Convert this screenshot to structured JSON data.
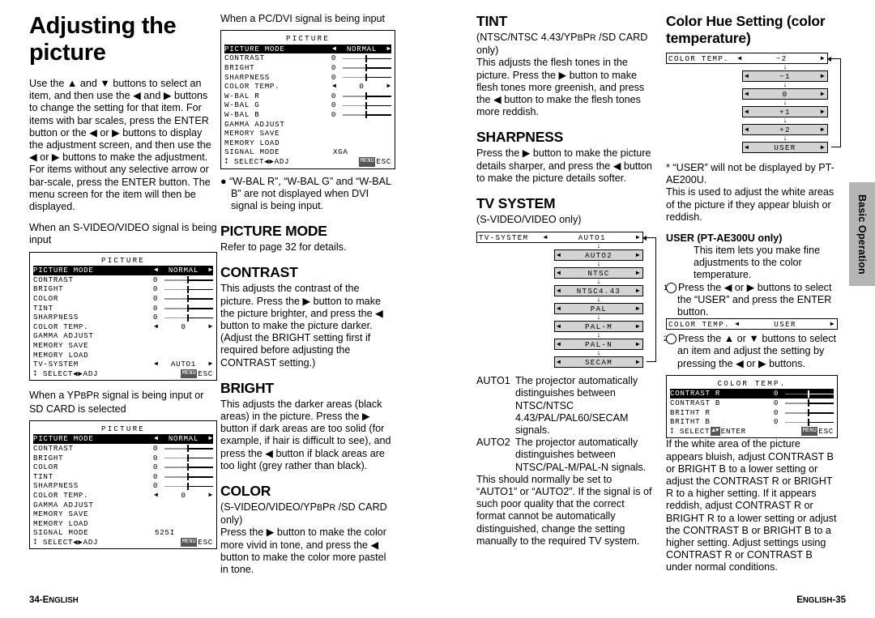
{
  "side_tab": {
    "label": "Basic Operation"
  },
  "footer": {
    "left": "34-ENGLISH",
    "right": "ENGLISH-35"
  },
  "col1": {
    "title": "Adjusting the picture",
    "p1": "Use the ▲ and ▼ buttons to select an item, and then use the ◀ and ▶ buttons to change the setting for that item. For items with bar scales, press the ENTER button or the ◀ or ▶ buttons to display the adjustment screen, and then use the ◀ or ▶ buttons to make the adjustment. For items without any selective arrow or bar-scale, press the ENTER button. The menu screen for the item will then be displayed.",
    "caption_svideo": "When an S-VIDEO/VIDEO signal is being input",
    "caption_ypbpr": "When a YPBPR signal is being input or SD CARD is selected",
    "menu_svideo": {
      "title": "PICTURE",
      "rows": [
        {
          "label": "PICTURE MODE",
          "type": "choice",
          "value": "NORMAL",
          "highlight": true
        },
        {
          "label": "CONTRAST",
          "type": "bar",
          "value": "0"
        },
        {
          "label": "BRIGHT",
          "type": "bar",
          "value": "0"
        },
        {
          "label": "COLOR",
          "type": "bar",
          "value": "0"
        },
        {
          "label": "TINT",
          "type": "bar",
          "value": "0"
        },
        {
          "label": "SHARPNESS",
          "type": "bar",
          "value": "0"
        },
        {
          "label": "COLOR  TEMP.",
          "type": "choice",
          "value": "0"
        },
        {
          "label": "GAMMA  ADJUST",
          "type": "plain",
          "value": ""
        },
        {
          "label": "MEMORY  SAVE",
          "type": "plain",
          "value": ""
        },
        {
          "label": "MEMORY  LOAD",
          "type": "plain",
          "value": ""
        },
        {
          "label": "TV-SYSTEM",
          "type": "choice",
          "value": "AUTO1"
        }
      ],
      "foot_select": "SELECT",
      "foot_adj": "ADJ",
      "foot_key": "MENU",
      "foot_esc": "ESC"
    },
    "menu_ypbpr": {
      "title": "PICTURE",
      "rows": [
        {
          "label": "PICTURE MODE",
          "type": "choice",
          "value": "NORMAL",
          "highlight": true
        },
        {
          "label": "CONTRAST",
          "type": "bar",
          "value": "0"
        },
        {
          "label": "BRIGHT",
          "type": "bar",
          "value": "0"
        },
        {
          "label": "COLOR",
          "type": "bar",
          "value": "0"
        },
        {
          "label": "TINT",
          "type": "bar",
          "value": "0"
        },
        {
          "label": "SHARPNESS",
          "type": "bar",
          "value": "0"
        },
        {
          "label": "COLOR  TEMP.",
          "type": "choice",
          "value": "0"
        },
        {
          "label": "GAMMA  ADJUST",
          "type": "plain",
          "value": ""
        },
        {
          "label": "MEMORY  SAVE",
          "type": "plain",
          "value": ""
        },
        {
          "label": "MEMORY  LOAD",
          "type": "plain",
          "value": ""
        },
        {
          "label": "SIGNAL  MODE",
          "type": "text",
          "value": "525I"
        }
      ],
      "foot_select": "SELECT",
      "foot_adj": "ADJ",
      "foot_key": "MENU",
      "foot_esc": "ESC"
    }
  },
  "col2": {
    "caption_pcdvi": "When a PC/DVI signal is being input",
    "menu_pcdvi": {
      "title": "PICTURE",
      "rows": [
        {
          "label": "PICTURE MODE",
          "type": "choice",
          "value": "NORMAL",
          "highlight": true
        },
        {
          "label": "CONTRAST",
          "type": "bar",
          "value": "0"
        },
        {
          "label": "BRIGHT",
          "type": "bar",
          "value": "0"
        },
        {
          "label": "SHARPNESS",
          "type": "bar",
          "value": "0"
        },
        {
          "label": "COLOR  TEMP.",
          "type": "choice",
          "value": "0"
        },
        {
          "label": "W-BAL  R",
          "type": "bar",
          "value": "0"
        },
        {
          "label": "W-BAL  G",
          "type": "bar",
          "value": "0"
        },
        {
          "label": "W-BAL  B",
          "type": "bar",
          "value": "0"
        },
        {
          "label": "GAMMA  ADJUST",
          "type": "plain",
          "value": ""
        },
        {
          "label": "MEMORY  SAVE",
          "type": "plain",
          "value": ""
        },
        {
          "label": "MEMORY  LOAD",
          "type": "plain",
          "value": ""
        },
        {
          "label": "SIGNAL  MODE",
          "type": "text",
          "value": "XGA"
        }
      ],
      "foot_select": "SELECT",
      "foot_adj": "ADJ",
      "foot_key": "MENU",
      "foot_esc": "ESC"
    },
    "note": "“W-BAL R”, “W-BAL G” and “W-BAL B” are not displayed when DVI signal is being input.",
    "h_picture_mode": "PICTURE MODE",
    "p_picture_mode": "Refer to page 32 for details.",
    "h_contrast": "CONTRAST",
    "p_contrast": "This adjusts the contrast of the picture. Press the ▶ button to make the picture brighter, and press the ◀ button to make the picture darker. (Adjust the BRIGHT setting first if required before adjusting the CONTRAST setting.)",
    "h_bright": "BRIGHT",
    "p_bright": "This adjusts the darker areas (black areas) in the picture. Press the ▶ button if dark areas are too solid (for example, if hair is difficult to see), and press the ◀ button if black areas are too light (grey rather than black).",
    "h_color": "COLOR",
    "p_color_sub": "(S-VIDEO/VIDEO/YPBPR /SD CARD only)",
    "p_color": "Press the ▶ button to make the color more vivid in tone, and press the ◀ button to make the color more pastel in tone."
  },
  "col3": {
    "h_tint": "TINT",
    "p_tint_sub": "(NTSC/NTSC 4.43/YPBPR /SD CARD only)",
    "p_tint": "This adjusts the flesh tones in the picture. Press the ▶ button to make flesh tones more greenish, and press the ◀ button to make the flesh tones more reddish.",
    "h_sharpness": "SHARPNESS",
    "p_sharpness": "Press the ▶ button to make the picture details sharper, and press the ◀ button to make the picture details softer.",
    "h_tvsystem": "TV SYSTEM",
    "p_tvsystem_sub": "(S-VIDEO/VIDEO only)",
    "cycle": {
      "head_label": "TV-SYSTEM",
      "options": [
        "AUTO1",
        "AUTO2",
        "NTSC",
        "NTSC4.43",
        "PAL",
        "PAL-M",
        "PAL-N",
        "SECAM"
      ]
    },
    "defs": [
      {
        "term": "AUTO1",
        "body": "The projector automatically distinguishes between NTSC/NTSC 4.43/PAL/PAL60/SECAM signals."
      },
      {
        "term": "AUTO2",
        "body": "The projector automatically distinguishes between NTSC/PAL-M/PAL-N signals."
      }
    ],
    "p_tail": "This should normally be set to “AUTO1” or “AUTO2”. If the signal is of such poor quality that the correct format cannot be automatically distinguished, change the setting manually to the required TV system."
  },
  "col4": {
    "h_colorhue": "Color Hue Setting (color temperature)",
    "cycle": {
      "head_label": "COLOR TEMP.",
      "options": [
        "−2",
        "−1",
        "0",
        "+1",
        "+2",
        "USER"
      ]
    },
    "note_user": "* “USER” will not be displayed by PT-AE200U.",
    "p_intro": "This is used to adjust the white areas of the picture if they appear bluish or reddish.",
    "h_user": "USER (PT-AE300U only)",
    "p_user": "This item lets you make fine adjustments to the color temperature.",
    "step1": "Press the ◀ or ▶ buttons to select the “USER” and press the ENTER button.",
    "strip_user": {
      "name": "COLOR TEMP.",
      "value": "USER"
    },
    "step2": "Press the ▲ or ▼ buttons to select an item and adjust the setting by pressing the ◀ or ▶ buttons.",
    "menu_colortemp": {
      "title": "COLOR  TEMP.",
      "rows": [
        {
          "label": "CONTRAST  R",
          "type": "bar",
          "value": "0",
          "highlight": true
        },
        {
          "label": "CONTRAST  B",
          "type": "bar",
          "value": "0"
        },
        {
          "label": "BRITHT  R",
          "type": "bar",
          "value": "0"
        },
        {
          "label": "BRITHT  B",
          "type": "bar",
          "value": "0"
        }
      ],
      "foot_select": "SELECT",
      "foot_key1": "▲▼",
      "foot_enter": "ENTER",
      "foot_key2": "MENU",
      "foot_esc": "ESC"
    },
    "p_tail": "If the white area of the picture appears bluish, adjust CONTRAST B or BRIGHT B to a lower setting or adjust the CONTRAST R or BRIGHT R to a higher setting. If it appears reddish, adjust CONTRAST R or BRIGHT R to a lower setting or adjust the CONTRAST B or BRIGHT B to a higher setting. Adjust settings using CONTRAST R or CONTRAST B under normal conditions."
  }
}
